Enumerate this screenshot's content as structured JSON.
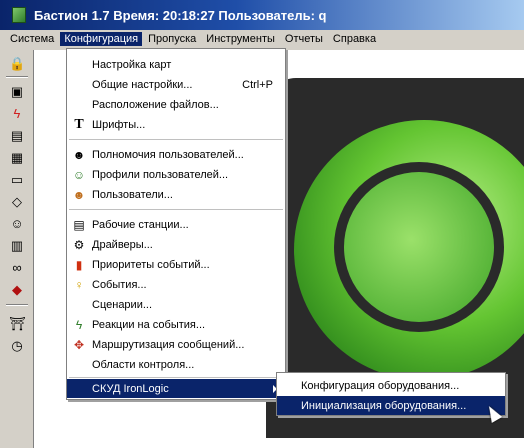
{
  "window": {
    "title": "Бастион 1.7 Время: 20:18:27 Пользователь: q"
  },
  "menubar": [
    "Система",
    "Конфигурация",
    "Пропуска",
    "Инструменты",
    "Отчеты",
    "Справка"
  ],
  "config_menu": {
    "items": [
      {
        "label": "Настройка карт",
        "icon": "none"
      },
      {
        "label": "Общие настройки...",
        "shortcut": "Ctrl+P",
        "icon": "none"
      },
      {
        "label": "Расположение файлов...",
        "icon": "none"
      },
      {
        "label": "Шрифты...",
        "icon": "T"
      },
      {
        "label": "Полномочия пользователей...",
        "icon": "user-rights-icon"
      },
      {
        "label": "Профили пользователей...",
        "icon": "user-profile-icon"
      },
      {
        "label": "Пользователи...",
        "icon": "users-icon"
      },
      {
        "label": "Рабочие станции...",
        "icon": "workstation-icon"
      },
      {
        "label": "Драйверы...",
        "icon": "driver-icon"
      },
      {
        "label": "Приоритеты событий...",
        "icon": "priority-icon"
      },
      {
        "label": "События...",
        "icon": "event-icon"
      },
      {
        "label": "Сценарии...",
        "icon": "none"
      },
      {
        "label": "Реакции на события...",
        "icon": "reaction-icon"
      },
      {
        "label": "Маршрутизация сообщений...",
        "icon": "routing-icon"
      },
      {
        "label": "Области контроля...",
        "icon": "none"
      },
      {
        "label": "СКУД IronLogic",
        "icon": "none",
        "submenu": true
      }
    ]
  },
  "submenu": {
    "items": [
      {
        "label": "Конфигурация оборудования..."
      },
      {
        "label": "Инициализация оборудования..."
      }
    ]
  },
  "colors": {
    "highlight": "#0a246a",
    "face": "#d4d0c8",
    "accent": "#64c532"
  }
}
